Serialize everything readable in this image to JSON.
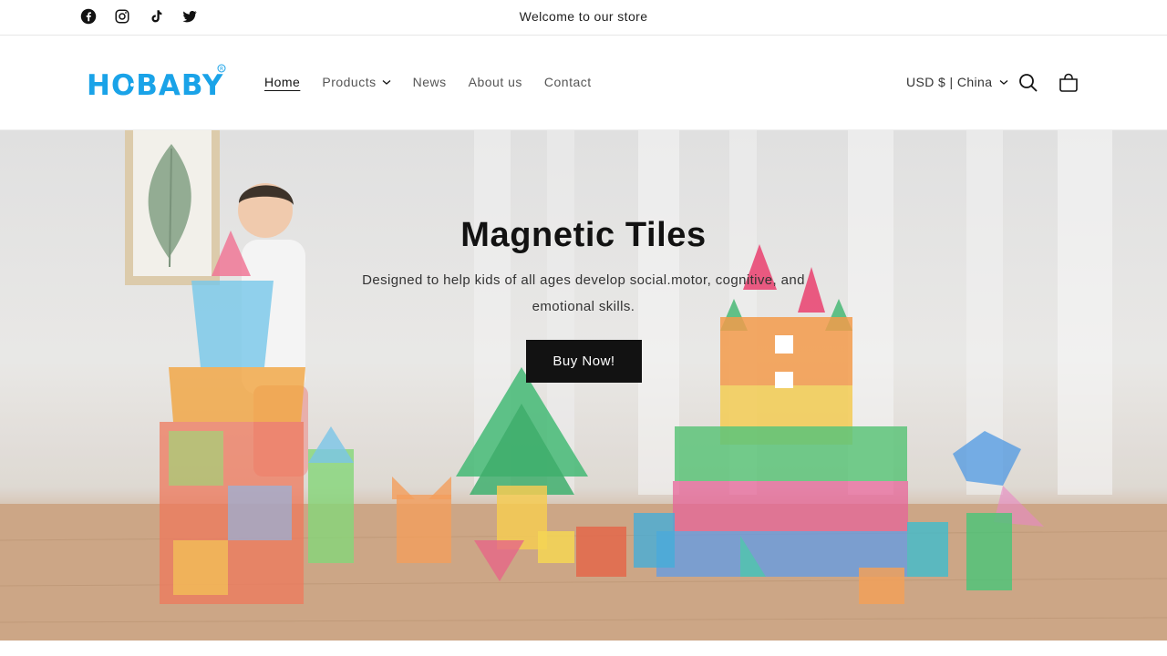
{
  "announcement": {
    "text": "Welcome to our store",
    "social_icons": [
      "facebook-icon",
      "instagram-icon",
      "tiktok-icon",
      "twitter-icon"
    ]
  },
  "header": {
    "logo_text": "HOBABY",
    "nav": {
      "home": "Home",
      "products": "Products",
      "news": "News",
      "about": "About us",
      "contact": "Contact"
    },
    "currency": "USD $ | China",
    "icons": [
      "search-icon",
      "cart-icon"
    ]
  },
  "hero": {
    "title": "Magnetic Tiles",
    "subtitle": "Designed to help kids of all ages develop social.motor, cognitive, and emotional skills.",
    "button_label": "Buy Now!"
  },
  "colors": {
    "brand_blue": "#1aa3e8",
    "button_bg": "#121212",
    "button_text": "#ffffff"
  }
}
